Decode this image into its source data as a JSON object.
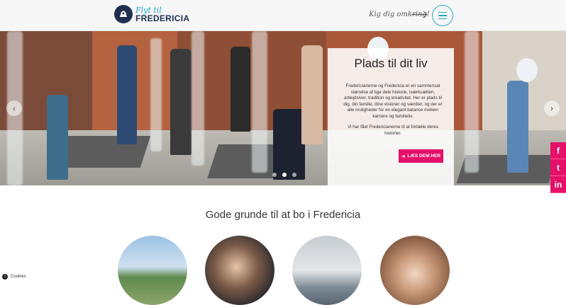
{
  "header": {
    "logo_line1": "Flyt til",
    "logo_line2": "FREDERICIA",
    "explore_label": "Kig dig omkring!"
  },
  "hero": {
    "card_title": "Plads til dit liv",
    "card_body": "Fredericianerne og Fredericia er en sammensat størrelse af lige dele historie, iværksætteri, arbejdsiver, tradition og kreativitet. Her er plads til dig, din familie, dine visioner og værdier, og der er alle muligheder for en elegant balance mellem karriere og familieliv.",
    "card_body2": "Vi har fået Fredericianerne til at fortælle deres historier.",
    "cta_label": "LÆS DEM HER",
    "prev_icon": "‹",
    "next_icon": "›",
    "slide_count": 3,
    "active_slide": 2
  },
  "social": {
    "facebook": "f",
    "twitter": "t",
    "linkedin": "in"
  },
  "section": {
    "title": "Gode grunde til at bo i Fredericia"
  },
  "cookies": {
    "label": "Cookies"
  },
  "colors": {
    "accent": "#29a9c4",
    "brand_navy": "#1f2f4f",
    "cta_pink": "#e5106a"
  }
}
